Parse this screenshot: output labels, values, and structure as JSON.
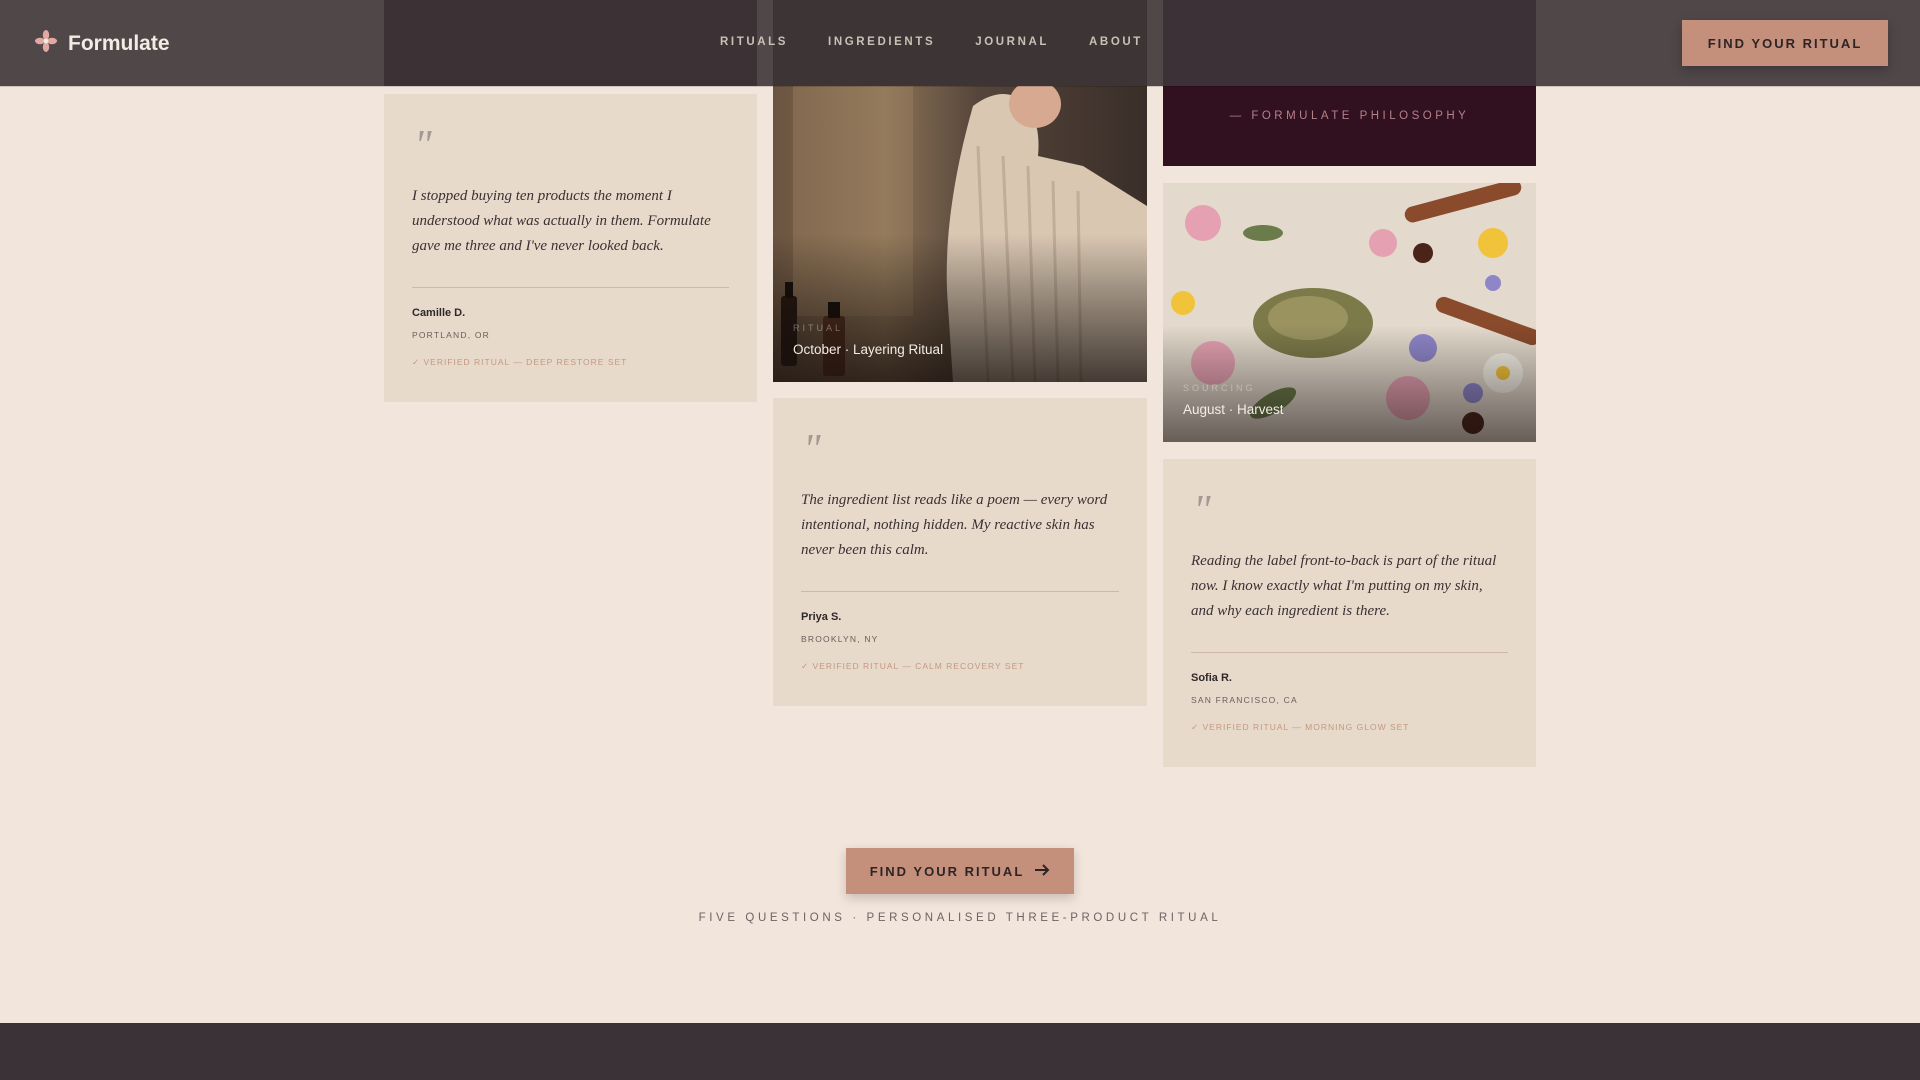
{
  "brand": {
    "name": "Formulate",
    "logo_icon": "flower-icon"
  },
  "nav": {
    "links": [
      "RITUALS",
      "INGREDIENTS",
      "JOURNAL",
      "ABOUT"
    ],
    "cta_label": "FIND YOUR RITUAL"
  },
  "philosophy": {
    "caption": "— FORMULATE PHILOSOPHY"
  },
  "testimonials": [
    {
      "quote": "I stopped buying ten products the moment I understood what was actually in them. Formulate gave me three and I've never looked back.",
      "name": "Camille D.",
      "location": "PORTLAND, OR",
      "verified": "✓ VERIFIED RITUAL — DEEP RESTORE SET"
    },
    {
      "quote": "The ingredient list reads like a poem — every word intentional, nothing hidden. My reactive skin has never been this calm.",
      "name": "Priya S.",
      "location": "BROOKLYN, NY",
      "verified": "✓ VERIFIED RITUAL — CALM RECOVERY SET"
    },
    {
      "quote": "Reading the label front-to-back is part of the ritual now. I know exactly what I'm putting on my skin, and why each ingredient is there.",
      "name": "Sofia R.",
      "location": "SAN FRANCISCO, CA",
      "verified": "✓ VERIFIED RITUAL — MORNING GLOW SET"
    }
  ],
  "images": [
    {
      "small_label": "RITUAL",
      "label": "October · Layering Ritual"
    },
    {
      "small_label": "SOURCING",
      "label": "August · Harvest"
    }
  ],
  "cta": {
    "label": "FIND YOUR RITUAL",
    "subtitle": "FIVE QUESTIONS · PERSONALISED THREE-PRODUCT RITUAL"
  },
  "colors": {
    "background": "#f2e5db",
    "card": "#e8dacb",
    "accent": "#c4907c",
    "nav": "#3e3538",
    "plum": "#31101f"
  }
}
